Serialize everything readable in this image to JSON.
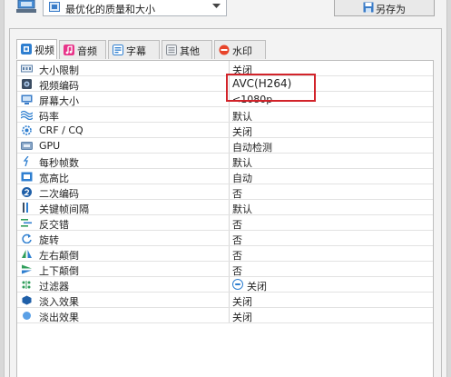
{
  "toolbar": {
    "preset_value": "最优化的质量和大小",
    "save_as_label": "另存为"
  },
  "tabs": [
    {
      "label": "视频",
      "icon": "video-icon",
      "color": "#2f7fd0",
      "active": true
    },
    {
      "label": "音频",
      "icon": "audio-icon",
      "color": "#e8348a",
      "active": false
    },
    {
      "label": "字幕",
      "icon": "subtitle-icon",
      "color": "#2f7fd0",
      "active": false
    },
    {
      "label": "其他",
      "icon": "other-icon",
      "color": "#8a8f96",
      "active": false
    },
    {
      "label": "水印",
      "icon": "watermark-icon",
      "color": "#e8442a",
      "active": false
    }
  ],
  "properties": [
    {
      "name": "大小限制",
      "value": "关闭",
      "icon": "size-limit-icon"
    },
    {
      "name": "视频编码",
      "value": "AVC(H264)",
      "icon": "video-encoder-icon"
    },
    {
      "name": "屏幕大小",
      "value": "<1080p",
      "icon": "screen-size-icon"
    },
    {
      "name": "码率",
      "value": "默认",
      "icon": "bitrate-icon"
    },
    {
      "name": "CRF / CQ",
      "value": "关闭",
      "icon": "crf-icon"
    },
    {
      "name": "GPU",
      "value": "自动检测",
      "icon": "gpu-icon"
    },
    {
      "name": "每秒帧数",
      "value": "默认",
      "icon": "fps-icon"
    },
    {
      "name": "宽高比",
      "value": "自动",
      "icon": "aspect-ratio-icon"
    },
    {
      "name": "二次编码",
      "value": "否",
      "icon": "two-pass-icon"
    },
    {
      "name": "关键帧间隔",
      "value": "默认",
      "icon": "keyframe-icon"
    },
    {
      "name": "反交错",
      "value": "否",
      "icon": "deinterlace-icon"
    },
    {
      "name": "旋转",
      "value": "否",
      "icon": "rotate-icon"
    },
    {
      "name": "左右颠倒",
      "value": "否",
      "icon": "flip-horizontal-icon"
    },
    {
      "name": "上下颠倒",
      "value": "否",
      "icon": "flip-vertical-icon"
    },
    {
      "name": "过滤器",
      "value": "关闭",
      "icon": "filter-icon"
    },
    {
      "name": "淡入效果",
      "value": "关闭",
      "icon": "fade-in-icon"
    },
    {
      "name": "淡出效果",
      "value": "关闭",
      "icon": "fade-out-icon"
    }
  ],
  "colors": {
    "highlight": "#d2232a",
    "accent": "#2f7fd0"
  }
}
